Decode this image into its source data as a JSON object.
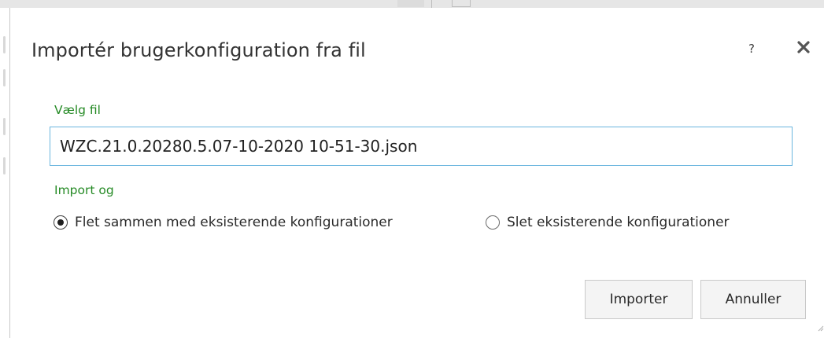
{
  "dialog": {
    "title": "Importér brugerkonfiguration fra fil",
    "help_label": "?",
    "close_icon": "close-icon"
  },
  "file_section": {
    "label": "Vælg fil",
    "value": "WZC.21.0.20280.5.07-10-2020 10-51-30.json"
  },
  "import_section": {
    "label": "Import og",
    "options": [
      {
        "label": "Flet sammen med eksisterende konfigurationer",
        "selected": true
      },
      {
        "label": "Slet eksisterende konfigurationer",
        "selected": false
      }
    ]
  },
  "buttons": {
    "import_label": "Importer",
    "cancel_label": "Annuller"
  },
  "colors": {
    "label_green": "#258a25",
    "input_border_focus": "#6bb6de",
    "button_bg": "#f4f4f4",
    "button_border": "#c9c9c9"
  }
}
